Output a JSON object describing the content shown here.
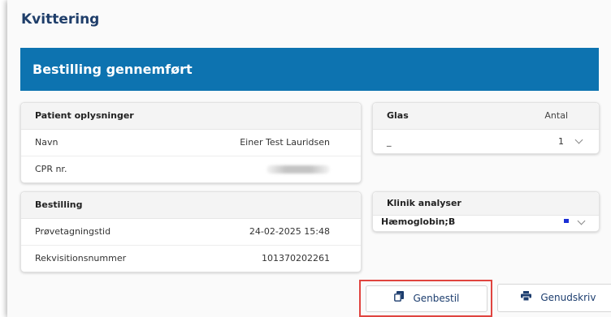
{
  "page": {
    "title": "Kvittering"
  },
  "banner": {
    "text": "Bestilling gennemført"
  },
  "patient": {
    "header": "Patient oplysninger",
    "rows": [
      {
        "label": "Navn",
        "value": "Einer Test Lauridsen"
      },
      {
        "label": "CPR nr.",
        "value": ""
      }
    ]
  },
  "glas": {
    "header": "Glas",
    "count_header": "Antal",
    "row": {
      "name": "_",
      "count": "1"
    }
  },
  "bestilling": {
    "header": "Bestilling",
    "rows": [
      {
        "label": "Prøvetagningstid",
        "value": "24-02-2025 15:48"
      },
      {
        "label": "Rekvisitionsnummer",
        "value": "101370202261"
      }
    ]
  },
  "klinik": {
    "header": "Klinik analyser",
    "row": {
      "name": "Hæmoglobin;B"
    }
  },
  "actions": {
    "reorder_label": "Genbestil",
    "reprint_label": "Genudskriv"
  },
  "colors": {
    "banner": "#0d73b0",
    "highlight": "#e0443f",
    "title": "#1f3e6a",
    "status_dot": "#1b2fd6"
  }
}
